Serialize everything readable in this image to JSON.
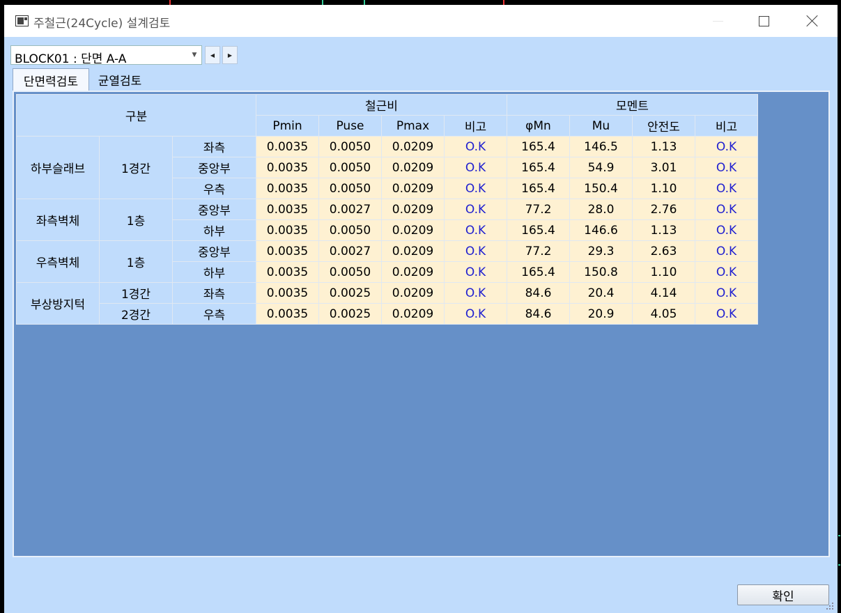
{
  "window": {
    "title": "주철근(24Cycle) 설계검토",
    "minimize_icon": "minimize-icon",
    "maximize_icon": "maximize-icon",
    "close_icon": "close-icon"
  },
  "selector": {
    "value": "BLOCK01 : 단면 A-A",
    "dropdown_icon": "chevron-down-icon",
    "prev_icon": "triangle-left-icon",
    "next_icon": "triangle-right-icon"
  },
  "tabs": [
    {
      "label": "단면력검토",
      "active": true
    },
    {
      "label": "균열검토",
      "active": false
    }
  ],
  "table": {
    "header_group": "구분",
    "group_rebar_ratio": "철근비",
    "group_moment": "모멘트",
    "columns": [
      "Pmin",
      "Puse",
      "Pmax",
      "비고",
      "φMn",
      "Mu",
      "안전도",
      "비고"
    ],
    "sections": [
      {
        "name": "하부슬래브",
        "subs": [
          {
            "span": "1경간",
            "rows": [
              {
                "pos": "좌측",
                "values": [
                  "0.0035",
                  "0.0050",
                  "0.0209",
                  "O.K",
                  "165.4",
                  "146.5",
                  "1.13",
                  "O.K"
                ]
              },
              {
                "pos": "중앙부",
                "values": [
                  "0.0035",
                  "0.0050",
                  "0.0209",
                  "O.K",
                  "165.4",
                  "54.9",
                  "3.01",
                  "O.K"
                ]
              },
              {
                "pos": "우측",
                "values": [
                  "0.0035",
                  "0.0050",
                  "0.0209",
                  "O.K",
                  "165.4",
                  "150.4",
                  "1.10",
                  "O.K"
                ]
              }
            ]
          }
        ]
      },
      {
        "name": "좌측벽체",
        "subs": [
          {
            "span": "1층",
            "rows": [
              {
                "pos": "중앙부",
                "values": [
                  "0.0035",
                  "0.0027",
                  "0.0209",
                  "O.K",
                  "77.2",
                  "28.0",
                  "2.76",
                  "O.K"
                ]
              },
              {
                "pos": "하부",
                "values": [
                  "0.0035",
                  "0.0050",
                  "0.0209",
                  "O.K",
                  "165.4",
                  "146.6",
                  "1.13",
                  "O.K"
                ]
              }
            ]
          }
        ]
      },
      {
        "name": "우측벽체",
        "subs": [
          {
            "span": "1층",
            "rows": [
              {
                "pos": "중앙부",
                "values": [
                  "0.0035",
                  "0.0027",
                  "0.0209",
                  "O.K",
                  "77.2",
                  "29.3",
                  "2.63",
                  "O.K"
                ]
              },
              {
                "pos": "하부",
                "values": [
                  "0.0035",
                  "0.0050",
                  "0.0209",
                  "O.K",
                  "165.4",
                  "150.8",
                  "1.10",
                  "O.K"
                ]
              }
            ]
          }
        ]
      },
      {
        "name": "부상방지턱",
        "subs": [
          {
            "span": "1경간",
            "rows": [
              {
                "pos": "좌측",
                "values": [
                  "0.0035",
                  "0.0025",
                  "0.0209",
                  "O.K",
                  "84.6",
                  "20.4",
                  "4.14",
                  "O.K"
                ]
              }
            ]
          },
          {
            "span": "2경간",
            "rows": [
              {
                "pos": "우측",
                "values": [
                  "0.0035",
                  "0.0025",
                  "0.0209",
                  "O.K",
                  "84.6",
                  "20.9",
                  "4.05",
                  "O.K"
                ]
              }
            ]
          }
        ]
      }
    ]
  },
  "buttons": {
    "confirm": "확인"
  },
  "colors": {
    "window_bg": "#c0dcfc",
    "panel_bg": "#6690c8",
    "value_cell_bg": "#fef1d2",
    "ok_text": "#2020d0"
  }
}
